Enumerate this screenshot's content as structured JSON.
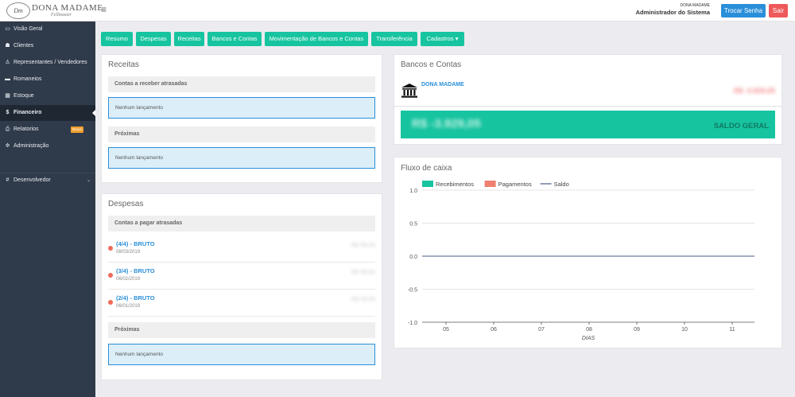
{
  "header": {
    "logo_name": "DONA MADAME",
    "logo_sub": "Fellmaster",
    "logo_mark": "Dm",
    "menu_icon": "hamburger-icon",
    "user_company": "DONA MADAME",
    "user_role": "Administrador do Sistema",
    "change_password_label": "Trocar Senha",
    "logout_label": "Sair"
  },
  "sidebar": {
    "items": [
      {
        "label": "Visão Geral",
        "icon": "monitor-icon",
        "glyph": "▭"
      },
      {
        "label": "Clientes",
        "icon": "users-icon",
        "glyph": "☗"
      },
      {
        "label": "Representantes / Vendedores",
        "icon": "user-tie-icon",
        "glyph": "♙"
      },
      {
        "label": "Romaneios",
        "icon": "truck-icon",
        "glyph": "▬"
      },
      {
        "label": "Estoque",
        "icon": "grid-icon",
        "glyph": "▦"
      },
      {
        "label": "Financeiro",
        "icon": "dollar-icon",
        "glyph": "$"
      },
      {
        "label": "Relatorios",
        "icon": "print-icon",
        "glyph": "⎙",
        "badge": "Breve"
      },
      {
        "label": "Administração",
        "icon": "gear-icon",
        "glyph": "✲"
      },
      {
        "label": "Desenvolvedor",
        "icon": "hash-icon",
        "glyph": "#"
      }
    ],
    "active": "Financeiro"
  },
  "tabs": [
    "Resumo",
    "Despesas",
    "Receitas",
    "Bancos e Contas",
    "Movimentação de Bancos e Contas",
    "Transferência",
    "Cadastros ▾"
  ],
  "receitas": {
    "title": "Receitas",
    "overdue_label": "Contas a receber atrasadas",
    "overdue_empty": "Nenhum lançamento",
    "upcoming_label": "Próximas",
    "upcoming_empty": "Nenhum lançamento"
  },
  "despesas": {
    "title": "Despesas",
    "overdue_label": "Contas a pagar atrasadas",
    "items": [
      {
        "title": "(4/4) - BRUTO",
        "date": "08/03/2019",
        "amount": "R$ 762,50"
      },
      {
        "title": "(3/4) - BRUTO",
        "date": "06/02/2019",
        "amount": "R$ 762,50"
      },
      {
        "title": "(2/4) - BRUTO",
        "date": "06/01/2019",
        "amount": "R$ 762,50"
      }
    ],
    "upcoming_label": "Próximas",
    "upcoming_empty": "Nenhum lançamento"
  },
  "bancos": {
    "title": "Bancos e Contas",
    "account_name": "DONA MADAME",
    "account_amount": "R$ -3.929,05",
    "balance_value": "R$ -3.929,05",
    "balance_label": "SALDO GERAL"
  },
  "fluxo": {
    "title": "Fluxo de caixa"
  },
  "chart_data": {
    "type": "line",
    "x": [
      "05",
      "06",
      "07",
      "08",
      "09",
      "10",
      "11"
    ],
    "xlabel": "DIAS",
    "ylim": [
      -1.0,
      1.0
    ],
    "yticks": [
      "1.0",
      "0.5",
      "0.0",
      "-0.5",
      "-1.0"
    ],
    "series": [
      {
        "name": "Recebimentos",
        "color": "#17c4a0",
        "values": [
          0,
          0,
          0,
          0,
          0,
          0,
          0
        ]
      },
      {
        "name": "Pagamentos",
        "color": "#f08070",
        "values": [
          0,
          0,
          0,
          0,
          0,
          0,
          0
        ]
      },
      {
        "name": "Saldo",
        "color": "#4a5a8a",
        "values": [
          0,
          0,
          0,
          0,
          0,
          0,
          0
        ]
      }
    ],
    "grid": true,
    "legend": "top-left"
  }
}
